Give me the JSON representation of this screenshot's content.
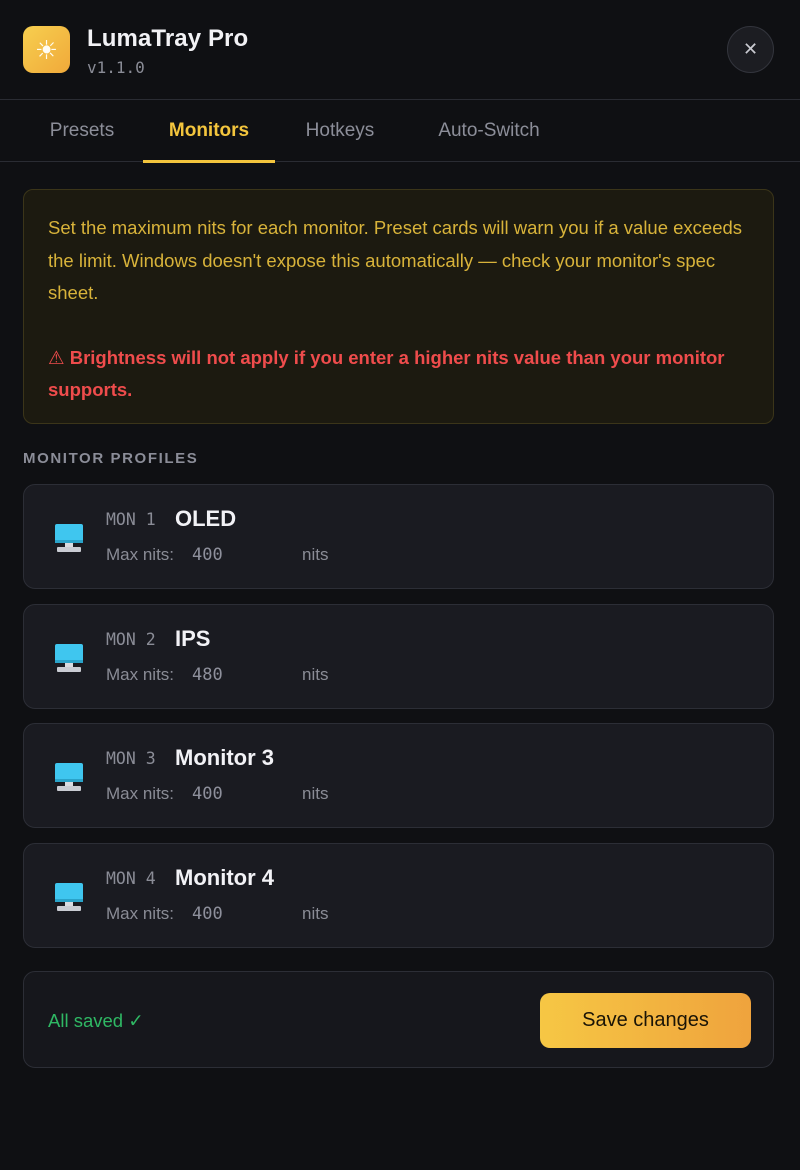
{
  "app": {
    "logo_icon": "sun-icon",
    "logo_glyph": "☀",
    "title": "LumaTray Pro",
    "version": "v1.1.0",
    "close_glyph": "✕"
  },
  "tabs": [
    {
      "label": "Presets",
      "active": false
    },
    {
      "label": "Monitors",
      "active": true
    },
    {
      "label": "Hotkeys",
      "active": false
    },
    {
      "label": "Auto-Switch",
      "active": false
    }
  ],
  "notice": {
    "text": "Set the maximum nits for each monitor. Preset cards will warn you if a value exceeds the limit. Windows doesn't expose this automatically — check your monitor's spec sheet.",
    "warning": "⚠ Brightness will not apply if you enter a higher nits value than your monitor supports."
  },
  "section_heading": "MONITOR PROFILES",
  "monitors": [
    {
      "id": "MON 1",
      "name": "OLED",
      "max_label": "Max nits:",
      "value": "400",
      "unit": "nits"
    },
    {
      "id": "MON 2",
      "name": "IPS",
      "max_label": "Max nits:",
      "value": "480",
      "unit": "nits"
    },
    {
      "id": "MON 3",
      "name": "Monitor 3",
      "max_label": "Max nits:",
      "value": "400",
      "unit": "nits"
    },
    {
      "id": "MON 4",
      "name": "Monitor 4",
      "max_label": "Max nits:",
      "value": "400",
      "unit": "nits"
    }
  ],
  "footer": {
    "status": "All saved ✓",
    "save_label": "Save changes"
  },
  "colors": {
    "accent": "#f3c53d",
    "background": "#0f1013",
    "card": "#1a1b21",
    "notice_text": "#d8b33a",
    "warning": "#ef4c4c",
    "success": "#2fb864",
    "monitor_icon": "#3fc6ef"
  }
}
